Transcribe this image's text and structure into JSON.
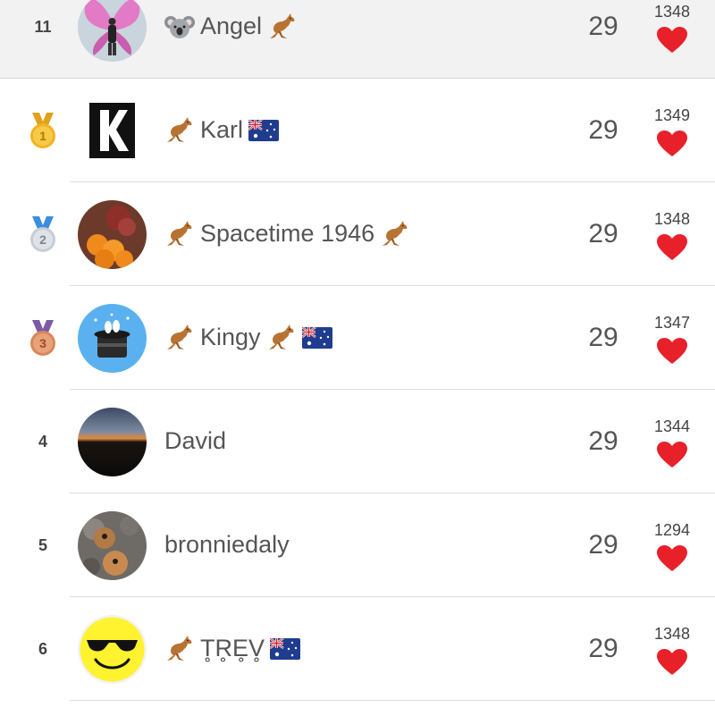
{
  "leaderboard": {
    "current_user": {
      "rank": "11",
      "name": "Angel",
      "score": "29",
      "likes": "1348",
      "emoji_before": "koala",
      "emoji_after": "kangaroo"
    },
    "rows": [
      {
        "rank": "1",
        "medal": "gold",
        "name": "Karl",
        "score": "29",
        "likes": "1349"
      },
      {
        "rank": "2",
        "medal": "silver",
        "name": "Spacetime 1946",
        "score": "29",
        "likes": "1348"
      },
      {
        "rank": "3",
        "medal": "bronze",
        "name": "Kingy",
        "score": "29",
        "likes": "1347"
      },
      {
        "rank": "4",
        "medal": "",
        "name": "David",
        "score": "29",
        "likes": "1344"
      },
      {
        "rank": "5",
        "medal": "",
        "name": "bronniedaly",
        "score": "29",
        "likes": "1294"
      },
      {
        "rank": "6",
        "medal": "",
        "name": "T̥R̥E̥V̥",
        "score": "29",
        "likes": "1348"
      }
    ]
  },
  "colors": {
    "heart": "#e8202a",
    "gold": "#f2b322",
    "silver": "#c7cdd3",
    "bronze": "#d9875a",
    "current_row_bg": "#f2f2f2"
  },
  "icons": {
    "like": "heart-icon",
    "kangaroo": "kangaroo-emoji-icon",
    "koala": "koala-emoji-icon",
    "australia_flag": "australia-flag-icon"
  }
}
